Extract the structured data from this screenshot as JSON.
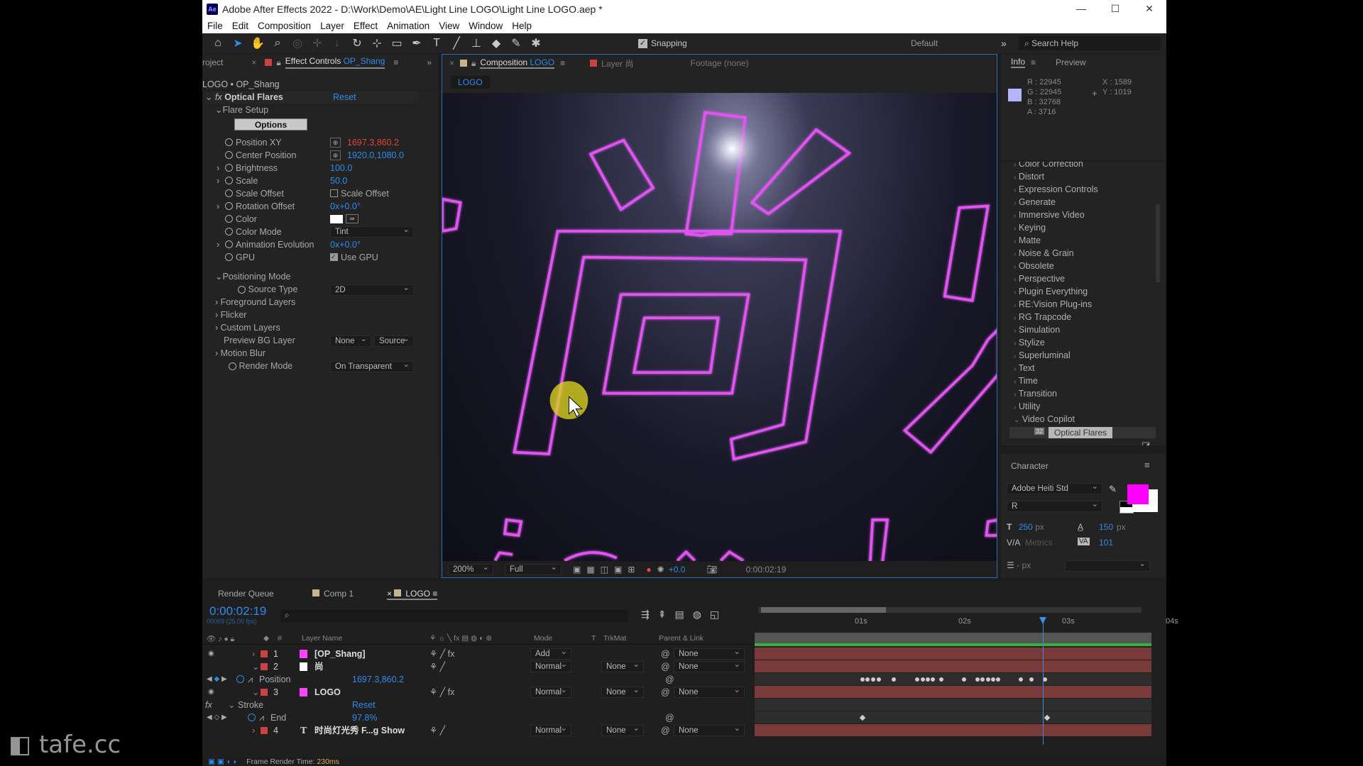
{
  "app": {
    "title": "Adobe After Effects 2022 - D:\\Work\\Demo\\AE\\Light Line LOGO\\Light Line LOGO.aep *",
    "logo": "Ae"
  },
  "menu": [
    "File",
    "Edit",
    "Composition",
    "Layer",
    "Effect",
    "Animation",
    "View",
    "Window",
    "Help"
  ],
  "toolbar": {
    "snapping": "Snapping",
    "workspace": "Default",
    "search_placeholder": "Search Help",
    "tools": [
      "home-icon",
      "selection-icon",
      "hand-icon",
      "zoom-icon",
      "orbit-icon",
      "pan-icon",
      "dolly-icon",
      "rotate-icon",
      "anchor-icon",
      "rectangle-icon",
      "pen-icon",
      "type-icon",
      "brush-icon",
      "clone-stamp-icon",
      "eraser-icon",
      "roto-brush-icon",
      "puppet-icon"
    ]
  },
  "effect_controls": {
    "tab_project": "roject",
    "tab_label": "Effect Controls",
    "tab_layer": "OP_Shang",
    "breadcrumb": "LOGO • OP_Shang",
    "effect_name": "Optical Flares",
    "reset": "Reset",
    "group_flare_setup": "Flare Setup",
    "options_button": "Options",
    "props": [
      {
        "label": "Position XY",
        "value": "1697.3,860.2",
        "kind": "point",
        "color": "red"
      },
      {
        "label": "Center Position",
        "value": "1920.0,1080.0",
        "kind": "point"
      },
      {
        "label": "Brightness",
        "value": "100.0",
        "expand": true
      },
      {
        "label": "Scale",
        "value": "50.0",
        "expand": true
      },
      {
        "label": "Scale Offset",
        "value": "Scale Offset",
        "kind": "checkbox",
        "checked": false
      },
      {
        "label": "Rotation Offset",
        "value": "0x+0.0°",
        "expand": true
      },
      {
        "label": "Color",
        "value": "",
        "kind": "color"
      },
      {
        "label": "Color Mode",
        "value": "Tint",
        "kind": "dropdown"
      },
      {
        "label": "Animation Evolution",
        "value": "0x+0.0°",
        "expand": true
      },
      {
        "label": "GPU",
        "value": "Use GPU",
        "kind": "checkbox",
        "checked": true
      }
    ],
    "positioning_mode": "Positioning Mode",
    "source_type_label": "Source Type",
    "source_type": "2D",
    "foreground_layers": "Foreground Layers",
    "flicker": "Flicker",
    "custom_layers": "Custom Layers",
    "preview_bg_label": "Preview BG Layer",
    "preview_bg_value": "None",
    "preview_bg_source": "Source",
    "motion_blur": "Motion Blur",
    "render_mode_label": "Render Mode",
    "render_mode": "On Transparent"
  },
  "composition": {
    "tab_label": "Composition",
    "tab_comp": "LOGO",
    "layer_tab": "Layer 尚",
    "footage_tab": "Footage (none)",
    "comp_chip": "LOGO",
    "zoom": "200%",
    "resolution": "Full",
    "exposure": "+0.0",
    "timecode": "0:00:02:19",
    "flare_color": "#e055f0"
  },
  "info": {
    "tab_info": "Info",
    "tab_preview": "Preview",
    "r": "R : 22945",
    "g": "G : 22945",
    "b": "B : 32768",
    "a": "A : 3716",
    "x": "X : 1589",
    "y": "Y : 1019",
    "swatch": "#b4b4ff"
  },
  "effects_list": [
    "Color Correction",
    "Distort",
    "Expression Controls",
    "Generate",
    "Immersive Video",
    "Keying",
    "Matte",
    "Noise & Grain",
    "Obsolete",
    "Perspective",
    "Plugin Everything",
    "RE:Vision Plug-ins",
    "RG Trapcode",
    "Simulation",
    "Stylize",
    "Superluminal",
    "Text",
    "Time",
    "Transition",
    "Utility",
    "Video Copilot"
  ],
  "effects_selected": "Optical Flares",
  "effects_selected_badge": "32",
  "character": {
    "title": "Character",
    "font": "Adobe Heiti Std",
    "style": "R",
    "size": "250",
    "size_unit": "px",
    "leading": "150",
    "leading_unit": "px",
    "kerning": "Metrics",
    "tracking": "101",
    "stroke": "- px",
    "fill_color": "#ff00ff"
  },
  "timeline": {
    "tabs": [
      "Render Queue",
      "Comp 1",
      "LOGO"
    ],
    "timecode": "0:00:02:19",
    "frames": "00069 (25.00 fps)",
    "headers": {
      "name": "Layer Name",
      "mode": "Mode",
      "t": "T",
      "trkmat": "TrkMat",
      "parent": "Parent & Link",
      "num": "#"
    },
    "ruler": [
      "01s",
      "02s",
      "03s",
      "04s"
    ],
    "playhead_seconds": 2.76,
    "layers": [
      {
        "num": "1",
        "name": "[OP_Shang]",
        "swatch": "#ff44ff",
        "mode": "Add",
        "trkmat": "",
        "parent": "None",
        "fx": true
      },
      {
        "num": "2",
        "name": "尚",
        "swatch": "#ffffff",
        "mode": "Normal",
        "trkmat": "None",
        "parent": "None",
        "fx": false
      },
      {
        "num": "3",
        "name": "LOGO",
        "swatch": "#ff44ff",
        "mode": "Normal",
        "trkmat": "None",
        "parent": "None",
        "fx": true
      },
      {
        "num": "4",
        "name": "时尚灯光秀 F...g Show",
        "swatch": "",
        "mode": "Normal",
        "trkmat": "None",
        "parent": "None",
        "fx": false
      }
    ],
    "position_prop": {
      "label": "Position",
      "value": "1697.3,860.2",
      "keyframes": [
        1.02,
        1.07,
        1.12,
        1.18,
        1.32,
        1.55,
        1.6,
        1.65,
        1.7,
        1.78,
        2.0,
        2.13,
        2.18,
        2.23,
        2.28,
        2.33,
        2.55,
        2.65,
        2.78
      ]
    },
    "stroke": {
      "label": "Stroke",
      "reset": "Reset"
    },
    "end_prop": {
      "label": "End",
      "value": "97.8%",
      "keyframes": [
        1.02,
        2.8
      ]
    },
    "status": "Frame Render Time:",
    "render_time": "230ms"
  },
  "watermark": "tafe.cc"
}
